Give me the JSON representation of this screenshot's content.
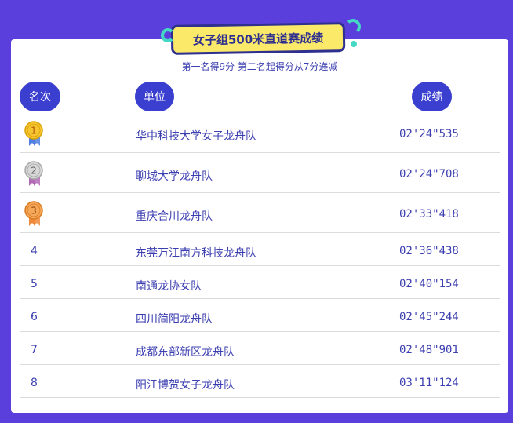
{
  "title": "女子组500米直道赛成绩",
  "subtitle": "第一名得9分 第二名起得分从7分递减",
  "headers": {
    "rank": "名次",
    "unit": "单位",
    "score": "成绩"
  },
  "rows": [
    {
      "rank": "1",
      "unit": "华中科技大学女子龙舟队",
      "score": "02'24\"535",
      "medal": "gold"
    },
    {
      "rank": "2",
      "unit": "聊城大学龙舟队",
      "score": "02'24\"708",
      "medal": "silver"
    },
    {
      "rank": "3",
      "unit": "重庆合川龙舟队",
      "score": "02'33\"418",
      "medal": "bronze"
    },
    {
      "rank": "4",
      "unit": "东莞万江南方科技龙舟队",
      "score": "02'36\"438"
    },
    {
      "rank": "5",
      "unit": "南通龙协女队",
      "score": "02'40\"154"
    },
    {
      "rank": "6",
      "unit": "四川简阳龙舟队",
      "score": "02'45\"244"
    },
    {
      "rank": "7",
      "unit": "成都东部新区龙舟队",
      "score": "02'48\"901"
    },
    {
      "rank": "8",
      "unit": "阳江博贺女子龙舟队",
      "score": "03'11\"124"
    }
  ],
  "colors": {
    "background": "#5a3fdc",
    "accent": "#3a3fcf",
    "banner": "#fbe96a",
    "text": "#3c3fb0"
  }
}
